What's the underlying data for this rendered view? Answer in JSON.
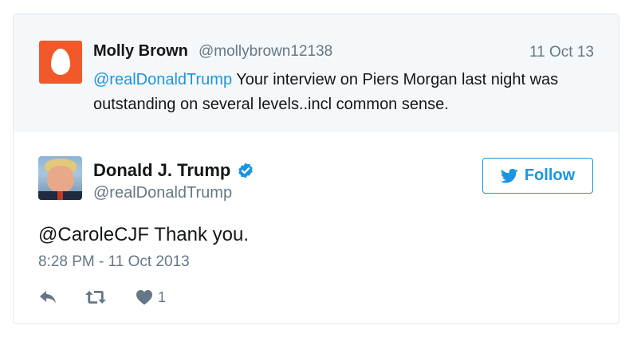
{
  "replied_tweet": {
    "author_name": "Molly Brown",
    "author_handle": "@mollybrown12138",
    "date": "11 Oct 13",
    "mention": "@realDonaldTrump",
    "text": " Your interview on Piers Morgan last night was outstanding on several levels..incl common sense."
  },
  "tweet": {
    "author_name": "Donald J. Trump",
    "author_handle": "@realDonaldTrump",
    "verified": true,
    "text": "@CaroleCJF Thank you.",
    "timestamp": "8:28 PM - 11 Oct 2013",
    "like_count": "1"
  },
  "follow_button": {
    "label": "Follow"
  },
  "colors": {
    "accent": "#1b95e0",
    "egg": "#f1592a",
    "muted": "#657786",
    "context_bg": "#f5f8fa"
  },
  "icons": [
    "egg-avatar-icon",
    "verified-badge-icon",
    "bird-icon",
    "reply-icon",
    "retweet-icon",
    "heart-icon"
  ]
}
